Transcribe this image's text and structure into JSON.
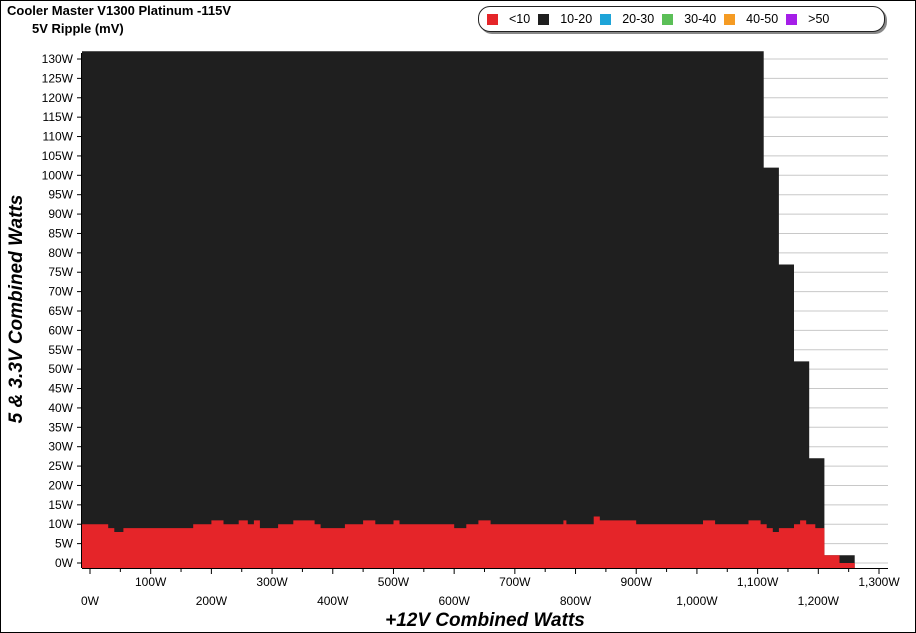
{
  "chart_data": {
    "type": "area",
    "title": "Cooler Master V1300 Platinum -115V",
    "subtitle": "5V Ripple (mV)",
    "xlabel": "+12V Combined Watts",
    "ylabel": "5 & 3.3V Combined Watts",
    "xlim": [
      0,
      1300
    ],
    "ylim": [
      0,
      130
    ],
    "x_ticks": [
      "0W",
      "100W",
      "200W",
      "300W",
      "400W",
      "500W",
      "600W",
      "700W",
      "800W",
      "900W",
      "1,000W",
      "1,100W",
      "1,200W",
      "1,300W"
    ],
    "y_ticks": [
      "0W",
      "5W",
      "10W",
      "15W",
      "20W",
      "25W",
      "30W",
      "35W",
      "40W",
      "45W",
      "50W",
      "55W",
      "60W",
      "65W",
      "70W",
      "75W",
      "80W",
      "85W",
      "90W",
      "95W",
      "100W",
      "105W",
      "110W",
      "115W",
      "120W",
      "125W",
      "130W"
    ],
    "grid": true,
    "legend_position": "top-right",
    "legend": [
      {
        "label": "<10",
        "color": "#e52529"
      },
      {
        "label": "10-20",
        "color": "#1f1f1f"
      },
      {
        "label": "20-30",
        "color": "#1ea4d8"
      },
      {
        "label": "30-40",
        "color": "#5bbf57"
      },
      {
        "label": "40-50",
        "color": "#f59b23"
      },
      {
        "label": ">50",
        "color": "#a51ee8"
      }
    ],
    "series": [
      {
        "name": "10-20",
        "color": "#1f1f1f",
        "x": [
          0,
          1110,
          1110,
          1135,
          1135,
          1160,
          1160,
          1185,
          1185,
          1210,
          1210,
          1235,
          1235,
          1260
        ],
        "values": [
          132,
          132,
          102,
          102,
          77,
          77,
          52,
          52,
          27,
          27,
          2,
          2,
          2,
          2
        ]
      },
      {
        "name": "<10",
        "color": "#e52529",
        "x": [
          0,
          30,
          30,
          40,
          40,
          55,
          55,
          70,
          70,
          170,
          170,
          180,
          180,
          200,
          200,
          220,
          220,
          245,
          245,
          260,
          260,
          270,
          270,
          280,
          280,
          310,
          310,
          335,
          335,
          370,
          370,
          380,
          380,
          420,
          420,
          450,
          450,
          470,
          470,
          500,
          500,
          510,
          510,
          530,
          530,
          545,
          545,
          560,
          560,
          600,
          600,
          620,
          620,
          640,
          640,
          660,
          660,
          685,
          685,
          710,
          710,
          735,
          735,
          780,
          780,
          785,
          785,
          800,
          800,
          830,
          830,
          840,
          840,
          850,
          850,
          880,
          880,
          900,
          900,
          950,
          950,
          970,
          970,
          1010,
          1010,
          1030,
          1030,
          1060,
          1060,
          1075,
          1075,
          1085,
          1085,
          1105,
          1105,
          1115,
          1115,
          1125,
          1125,
          1135,
          1135,
          1160,
          1160,
          1170,
          1170,
          1180,
          1180,
          1195,
          1195,
          1205,
          1205,
          1210,
          1210,
          1225,
          1225,
          1235,
          1235,
          1260
        ],
        "values": [
          10,
          10,
          9,
          9,
          8,
          8,
          9,
          9,
          9,
          9,
          10,
          10,
          10,
          10,
          11,
          11,
          10,
          10,
          11,
          11,
          10,
          10,
          11,
          11,
          9,
          9,
          10,
          10,
          11,
          11,
          10,
          10,
          9,
          9,
          10,
          10,
          11,
          11,
          10,
          10,
          11,
          11,
          10,
          10,
          10,
          10,
          10,
          10,
          10,
          10,
          9,
          9,
          10,
          10,
          11,
          11,
          10,
          10,
          10,
          10,
          10,
          10,
          10,
          10,
          11,
          11,
          10,
          10,
          10,
          10,
          12,
          12,
          11,
          11,
          11,
          11,
          11,
          11,
          10,
          10,
          10,
          10,
          10,
          10,
          11,
          11,
          10,
          10,
          10,
          10,
          10,
          10,
          11,
          11,
          10,
          10,
          9,
          9,
          8,
          8,
          9,
          9,
          10,
          10,
          11,
          11,
          10,
          10,
          9,
          9,
          9,
          9,
          2,
          2,
          2,
          2,
          0,
          0
        ]
      }
    ]
  }
}
